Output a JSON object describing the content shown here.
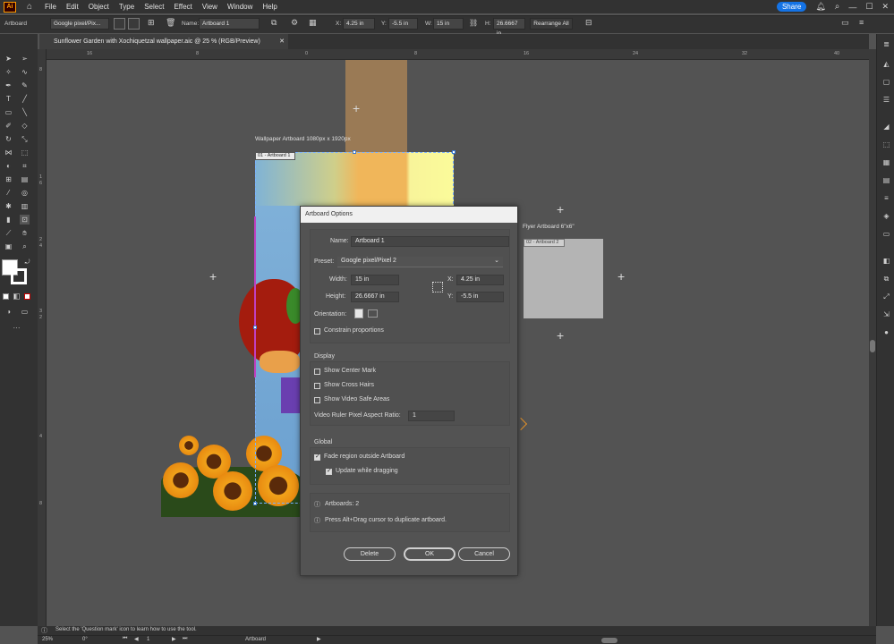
{
  "app": {
    "logo": "Ai"
  },
  "menu": [
    "File",
    "Edit",
    "Object",
    "Type",
    "Select",
    "Effect",
    "View",
    "Window",
    "Help"
  ],
  "share_label": "Share",
  "control_bar": {
    "mode_label": "Artboard",
    "preset": "Google pixel/Pix...",
    "name_label": "Name:",
    "name_value": "Artboard 1",
    "x_label": "X:",
    "x_value": "4.25 in",
    "y_label": "Y:",
    "y_value": "-5.5 in",
    "w_label": "W:",
    "w_value": "15 in",
    "h_label": "H:",
    "h_value": "26.6667 in",
    "rearrange_label": "Rearrange All"
  },
  "document_tab": {
    "title": "Sunflower Garden with Xochiquetzal wallpaper.aic @ 25 % (RGB/Preview)"
  },
  "ruler": {
    "top_ticks": [
      "16",
      "8",
      "0",
      "8",
      "16",
      "24",
      "32",
      "40"
    ],
    "left_ticks": [
      "8",
      "1",
      "6",
      "2",
      "4",
      "3",
      "2",
      "4",
      "8"
    ]
  },
  "artboards": [
    {
      "label": "Wallpaper Artboard 1080px x 1920px",
      "tag": "01 - Artboard 1"
    },
    {
      "label": "Flyer Artboard 6\"x6\"",
      "tag": "02 - Artboard 2"
    }
  ],
  "dialog": {
    "title": "Artboard Options",
    "name_label": "Name:",
    "name_value": "Artboard 1",
    "preset_label": "Preset:",
    "preset_value": "Google pixel/Pixel 2",
    "width_label": "Width:",
    "width_value": "15 in",
    "height_label": "Height:",
    "height_value": "26.6667 in",
    "x_label": "X:",
    "x_value": "4.25 in",
    "y_label": "Y:",
    "y_value": "-5.5 in",
    "orientation_label": "Orientation:",
    "constrain_label": "Constrain proportions",
    "display_heading": "Display",
    "show_center_mark": "Show Center Mark",
    "show_cross_hairs": "Show Cross Hairs",
    "show_video_safe": "Show Video Safe Areas",
    "video_ratio_label": "Video Ruler Pixel Aspect Ratio:",
    "video_ratio_value": "1",
    "global_heading": "Global",
    "fade_label": "Fade region outside Artboard",
    "update_label": "Update while dragging",
    "artboards_count": "Artboards: 2",
    "hint": "Press Alt+Drag cursor to duplicate artboard.",
    "delete_label": "Delete",
    "ok_label": "OK",
    "cancel_label": "Cancel"
  },
  "status": {
    "hint": "Select the 'Question mark' icon to learn how to use the tool.",
    "zoom": "25%",
    "rotation": "0°",
    "artboard_num": "1",
    "tool_name": "Artboard"
  },
  "colors": {
    "accent": "#1473e6",
    "dialog_title_bg": "#f0f0f0",
    "orange": "#f0b65a"
  }
}
